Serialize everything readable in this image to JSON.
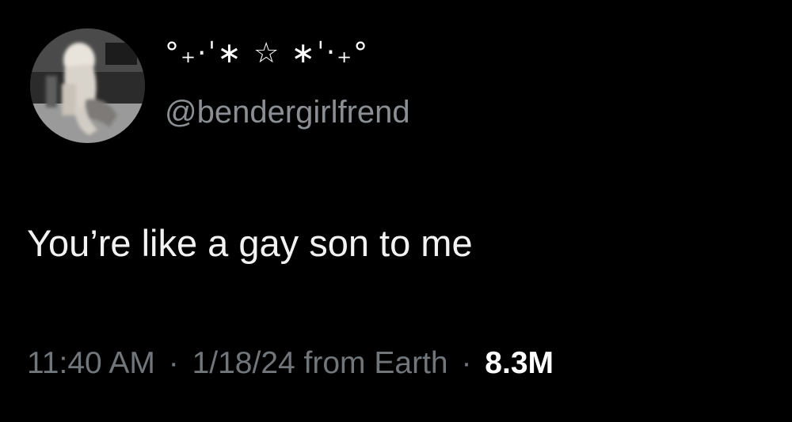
{
  "tweet": {
    "author": {
      "display_name": "°₊·ˈ∗ ☆ ∗ˈ‧₊°",
      "handle": "@bendergirlfrend",
      "avatar_icon": "profile-photo"
    },
    "text": "You’re like a gay son to me",
    "time": "11:40 AM",
    "date": "1/18/24",
    "source": "from Earth",
    "separator": "·",
    "views": "8.3M"
  },
  "colors": {
    "background": "#000000",
    "text_primary": "#f2f2f2",
    "text_secondary": "#71767b"
  }
}
